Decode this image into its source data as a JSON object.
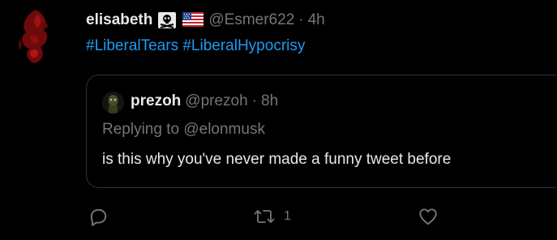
{
  "colors": {
    "background": "#000000",
    "primary_text": "#e7e9ea",
    "secondary_text": "#71767b",
    "link": "#1d9bf0",
    "border": "#2f3336"
  },
  "tweet": {
    "author": {
      "display_name": "elisabeth",
      "badges": [
        "skull-crossbones-icon",
        "us-flag-icon"
      ],
      "handle": "@Esmer622",
      "separator": "·",
      "time": "4h"
    },
    "hashtags": [
      "#LiberalTears",
      "#LiberalHypocrisy"
    ],
    "quoted": {
      "display_name": "prezoh",
      "handle": "@prezoh",
      "separator": "·",
      "time": "8h",
      "replying_prefix": "Replying to ",
      "replying_to": "@elonmusk",
      "text": "is this why you've never made a funny tweet before"
    },
    "actions": {
      "reply_icon": "reply-icon",
      "retweet_icon": "retweet-icon",
      "retweet_count": "1",
      "like_icon": "heart-icon"
    }
  }
}
